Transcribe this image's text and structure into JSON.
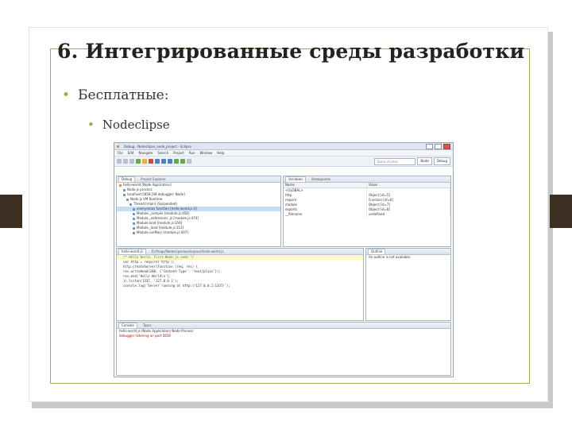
{
  "slide": {
    "title": "6. Интегрированные среды разработки",
    "bullet_level1": "Бесплатные:",
    "bullet_level2": "Nodeclipse"
  },
  "colors": {
    "accent": "#8fb33b",
    "tab": "#3d2e22"
  },
  "ide": {
    "window_title": "Debug - Nodeclipse_node_project - Eclipse",
    "menu": [
      "File",
      "Edit",
      "Navigate",
      "Search",
      "Project",
      "Run",
      "Window",
      "Help"
    ],
    "quick_access": "Quick Access",
    "perspective_node": "Node",
    "perspective_debug": "Debug",
    "debug_tab": "Debug",
    "servers_tab": "Project Explorer",
    "debug_tree": [
      "hello-world [Node Application]",
      "Node.js process",
      "localhost:5858 [V8 debugger: Node]",
      "Node.js VM Runtime",
      "Thread [main] (Suspended)",
      "anonymous function [hello-world.js:3]",
      "Module._compile [module.js:456]",
      "Module._extensions..js [module.js:474]",
      "Module.load [module.js:356]",
      "Module._load [module.js:312]",
      "Module.runMain [module.js:497]"
    ],
    "variables_tab": "Variables",
    "breakpoints_tab": "Breakpoints",
    "var_header_name": "Name",
    "var_header_value": "Value",
    "variables": [
      {
        "name": "<GLOBAL>",
        "value": ""
      },
      {
        "name": "http",
        "value": "Object [id=5]"
      },
      {
        "name": "require",
        "value": "Function [id=6]"
      },
      {
        "name": "module",
        "value": "Object [id=7]"
      },
      {
        "name": "exports",
        "value": "Object [id=8]"
      },
      {
        "name": "__filename",
        "value": "undefined"
      }
    ],
    "editor_tab": "hello-world.js",
    "editor_path": "D:/Progs/Nodeclipse/workspace/hello-world.js",
    "code": [
      "/* Hello World, first Node.js code */",
      "var http = require('http');",
      "http.createServer(function (req, res) {",
      "  res.writeHead(200, {'Content-Type': 'text/plain'});",
      "  res.end('Hello World\\n');",
      "}).listen(1337, '127.0.0.1');",
      "console.log('Server running at http://127.0.0.1:1337/');"
    ],
    "outline_tab": "Outline",
    "outline_text": "An outline is not available.",
    "console_tab": "Console",
    "tasks_tab": "Tasks",
    "console_lines": [
      "hello-world.js [Node Application] Node Process",
      "debugger listening on port 5858"
    ]
  }
}
